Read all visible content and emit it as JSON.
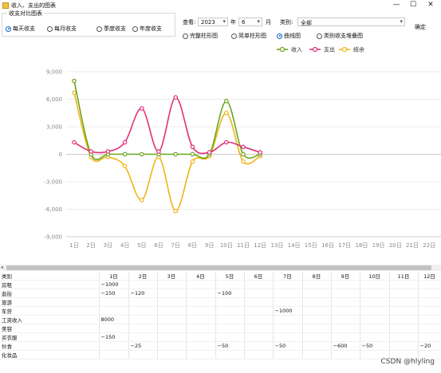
{
  "window": {
    "title": "收入、支出的图表",
    "minimize": "—",
    "maximize": "☐",
    "close": "✕"
  },
  "compare_group": {
    "legend": "收支对比图表",
    "options": [
      {
        "label": "每天收支",
        "selected": true
      },
      {
        "label": "每月收支",
        "selected": false
      },
      {
        "label": "季度收支",
        "selected": false
      },
      {
        "label": "年度收支",
        "selected": false
      }
    ]
  },
  "filters": {
    "view_label": "查看:",
    "year": "2023",
    "year_unit": "年",
    "month": "6",
    "month_unit": "月",
    "category_label": "类别:",
    "category": "全部",
    "confirm": "确定"
  },
  "chart_types": [
    {
      "label": "完整柱形图",
      "selected": false
    },
    {
      "label": "简单柱形图",
      "selected": false
    },
    {
      "label": "曲线图",
      "selected": true
    },
    {
      "label": "类别收支堆叠图",
      "selected": false
    }
  ],
  "chart_data": {
    "type": "line",
    "categories": [
      "1日",
      "2日",
      "3日",
      "4日",
      "5日",
      "6日",
      "7日",
      "8日",
      "9日",
      "10日",
      "11日",
      "12日",
      "13日",
      "14日",
      "15日",
      "16日",
      "17日",
      "18日",
      "19日",
      "20日",
      "21日",
      "22日"
    ],
    "series": [
      {
        "name": "收入",
        "color": "#6aa61e",
        "values": [
          8000,
          0,
          0,
          0,
          0,
          0,
          0,
          0,
          0,
          5800,
          0,
          0
        ]
      },
      {
        "name": "支出",
        "color": "#e0307a",
        "values": [
          1300,
          300,
          300,
          1300,
          5000,
          300,
          6200,
          800,
          200,
          1300,
          800,
          200
        ]
      },
      {
        "name": "结余",
        "color": "#f0b418",
        "values": [
          6700,
          -300,
          -300,
          -1300,
          -5000,
          -300,
          -6200,
          -800,
          -200,
          4500,
          -800,
          -200
        ]
      }
    ],
    "yticks": [
      "9,000",
      "6,000",
      "3,000",
      "0",
      "-3,000",
      "-6,000",
      "-9,000"
    ],
    "ylim": [
      -9000,
      9000
    ],
    "grid": true,
    "legend": "top-right"
  },
  "table": {
    "headers": [
      "类别",
      "1日",
      "2日",
      "3日",
      "4日",
      "5日",
      "6日",
      "7日",
      "8日",
      "9日",
      "10日",
      "11日",
      "12日"
    ],
    "rows": [
      [
        "房租",
        "−1000",
        "",
        "",
        "",
        "",
        "",
        "",
        "",
        "",
        "",
        "",
        ""
      ],
      [
        "逛街",
        "−150",
        "−120",
        "",
        "",
        "−100",
        "",
        "",
        "",
        "",
        "",
        "",
        ""
      ],
      [
        "旅游",
        "",
        "",
        "",
        "",
        "",
        "",
        "",
        "",
        "",
        "",
        "",
        ""
      ],
      [
        "车贷",
        "",
        "",
        "",
        "",
        "",
        "",
        "−1000",
        "",
        "",
        "",
        "",
        ""
      ],
      [
        "工资收入",
        "8000",
        "",
        "",
        "",
        "",
        "",
        "",
        "",
        "",
        "",
        "",
        ""
      ],
      [
        "美容",
        "",
        "",
        "",
        "",
        "",
        "",
        "",
        "",
        "",
        "",
        "",
        ""
      ],
      [
        "买衣服",
        "−150",
        "",
        "",
        "",
        "",
        "",
        "",
        "",
        "",
        "",
        "",
        ""
      ],
      [
        "伙食",
        "",
        "−25",
        "",
        "",
        "−50",
        "",
        "−50",
        "",
        "−600",
        "−50",
        "",
        "−20"
      ],
      [
        "化妆品",
        "",
        "",
        "",
        "",
        "",
        "",
        "",
        "",
        "",
        "",
        "",
        ""
      ]
    ]
  },
  "watermark": "CSDN @hlyling"
}
